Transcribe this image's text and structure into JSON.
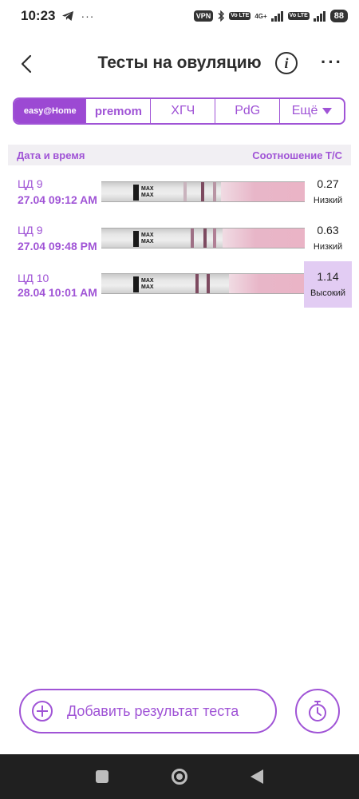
{
  "status_bar": {
    "time": "10:23",
    "dots": "···",
    "vpn": "VPN",
    "volte": "Vo LTE",
    "network": "4G+",
    "battery": "88"
  },
  "header": {
    "title": "Тесты на овуляцию",
    "info_symbol": "i",
    "more_symbol": "···"
  },
  "tabs": [
    {
      "label": "easy@Home"
    },
    {
      "label": "premom"
    },
    {
      "label": "ХГЧ"
    },
    {
      "label": "PdG"
    },
    {
      "label": "Ещё"
    }
  ],
  "table": {
    "header_left": "Дата и время",
    "header_right": "Соотношение Т/С",
    "rows": [
      {
        "cd": "ЦД 9",
        "datetime": "27.04   09:12 AM",
        "ratio": "0.27",
        "level": "Низкий",
        "high": false
      },
      {
        "cd": "ЦД 9",
        "datetime": "27.04   09:48 PM",
        "ratio": "0.63",
        "level": "Низкий",
        "high": false
      },
      {
        "cd": "ЦД 10",
        "datetime": "28.04   10:01 AM",
        "ratio": "1.14",
        "level": "Высокий",
        "high": true
      }
    ],
    "strip_text": "MAX"
  },
  "bottom": {
    "add_label": "Добавить результат теста"
  },
  "colors": {
    "accent": "#a054d6",
    "tab_active_bg": "#9c49d3",
    "high_bg": "#e2ccf3",
    "header_bg": "#f1eff3"
  }
}
